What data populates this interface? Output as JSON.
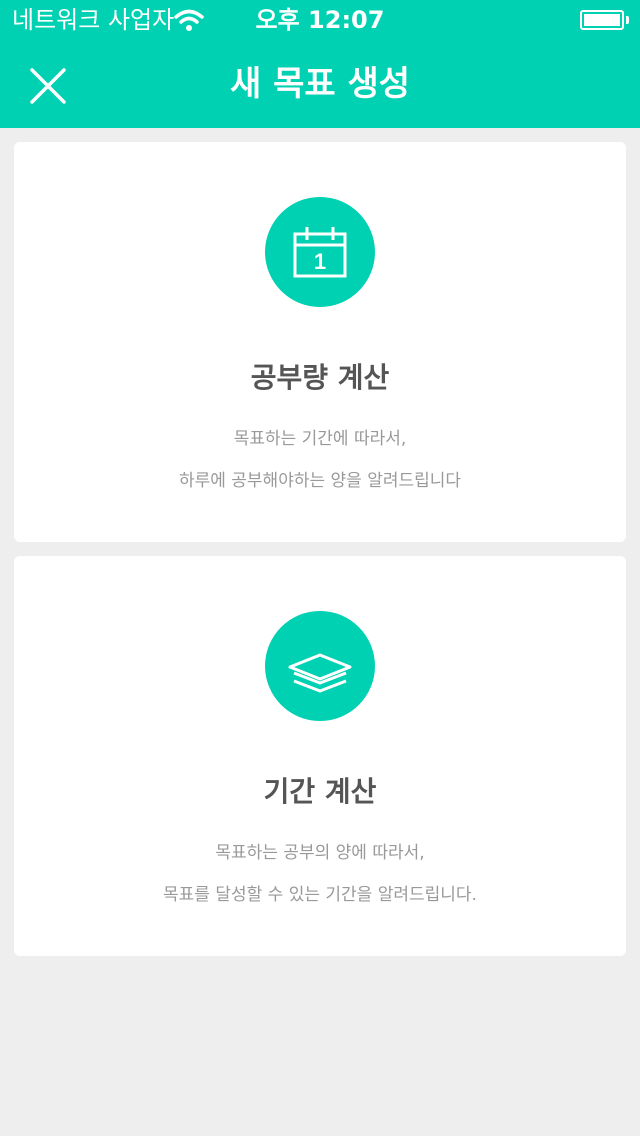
{
  "status_bar": {
    "carrier": "네트워크 사업자",
    "time": "오후 12:07",
    "icons": [
      "wifi-icon",
      "battery-icon"
    ]
  },
  "nav": {
    "title": "새 목표 생성",
    "close_icon": "close-icon"
  },
  "options": [
    {
      "icon": "calendar-icon",
      "icon_number": "1",
      "title": "공부량 계산",
      "desc_line1": "목표하는 기간에 따라서,",
      "desc_line2": "하루에 공부해야하는 양을 알려드립니다"
    },
    {
      "icon": "layers-icon",
      "title": "기간 계산",
      "desc_line1": "목표하는 공부의 양에 따라서,",
      "desc_line2": "목표를 달성할 수 있는 기간을 알려드립니다."
    }
  ],
  "colors": {
    "accent": "#00d1b2",
    "background": "#eeeeee",
    "card": "#ffffff",
    "title_text": "#555555",
    "desc_text": "#999999"
  }
}
